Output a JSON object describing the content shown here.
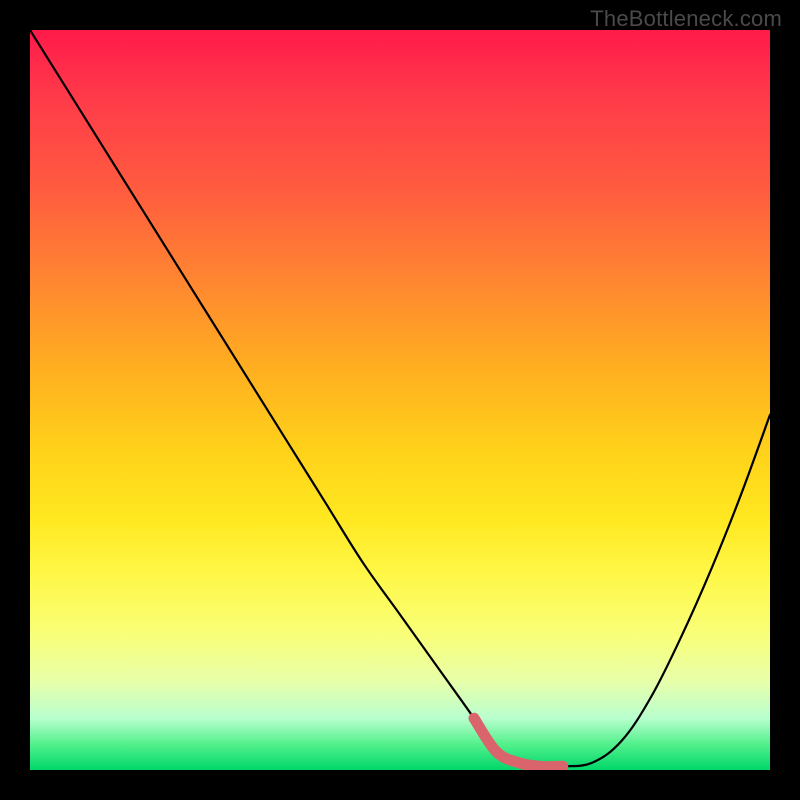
{
  "watermark": "TheBottleneck.com",
  "colors": {
    "background": "#000000",
    "curve": "#000000",
    "highlight": "#d9646b",
    "gradient_top": "#ff1a4a",
    "gradient_bottom": "#00d76a"
  },
  "chart_data": {
    "type": "line",
    "title": "",
    "xlabel": "",
    "ylabel": "",
    "xlim": [
      0,
      100
    ],
    "ylim": [
      0,
      100
    ],
    "grid": false,
    "legend": false,
    "series": [
      {
        "name": "bottleneck-curve",
        "x": [
          0,
          5,
          10,
          15,
          20,
          25,
          30,
          35,
          40,
          45,
          50,
          55,
          60,
          63,
          66,
          69,
          72,
          76,
          80,
          84,
          88,
          92,
          96,
          100
        ],
        "values": [
          100,
          92,
          84,
          76,
          68,
          60,
          52,
          44,
          36,
          28,
          21,
          14,
          7,
          2.5,
          1,
          0.5,
          0.5,
          1,
          4,
          10,
          18,
          27,
          37,
          48
        ]
      }
    ],
    "highlight_segment": {
      "x_start": 60,
      "x_end": 72
    }
  }
}
